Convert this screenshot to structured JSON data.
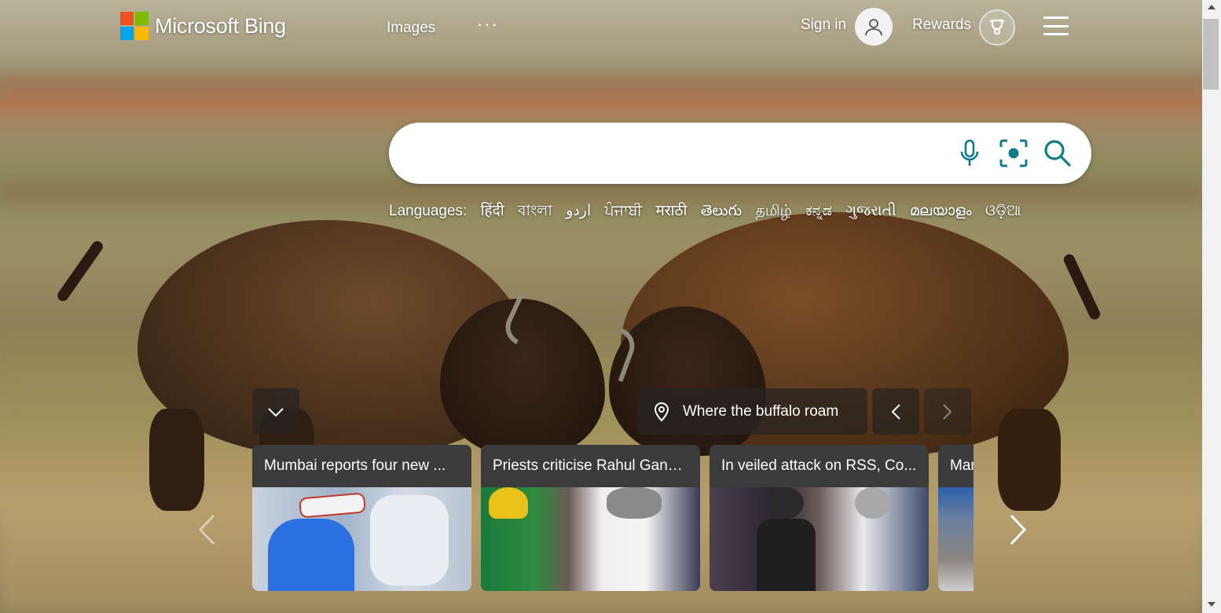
{
  "header": {
    "brand": "Microsoft Bing",
    "nav_images": "Images",
    "nav_more": "···",
    "sign_in": "Sign in",
    "rewards": "Rewards"
  },
  "search": {
    "placeholder": ""
  },
  "languages": {
    "label": "Languages:",
    "items": [
      "हिंदी",
      "বাংলা",
      "اردو",
      "ਪੰਜਾਬੀ",
      "मराठी",
      "తెలుగు",
      "தமிழ்",
      "ಕನ್ನಡ",
      "ગુજરાતી",
      "മലയാളം",
      "ଓଡ଼ିଆ"
    ]
  },
  "image_info": {
    "caption": "Where the buffalo roam"
  },
  "news": [
    {
      "title": "Mumbai reports four new ..."
    },
    {
      "title": "Priests criticise Rahul Gand..."
    },
    {
      "title": "In veiled attack on RSS, Co..."
    },
    {
      "title": "Mar"
    }
  ],
  "colors": {
    "ms_red": "#f25022",
    "ms_green": "#7fba00",
    "ms_blue": "#00a4ef",
    "ms_yellow": "#ffb900",
    "search_icon": "#0f7b8c"
  },
  "icons": [
    "microsoft-logo-icon",
    "person-icon",
    "trophy-icon",
    "hamburger-icon",
    "microphone-icon",
    "visual-search-icon",
    "search-icon",
    "chevron-down-icon",
    "location-pin-icon",
    "chevron-left-icon",
    "chevron-right-icon"
  ]
}
